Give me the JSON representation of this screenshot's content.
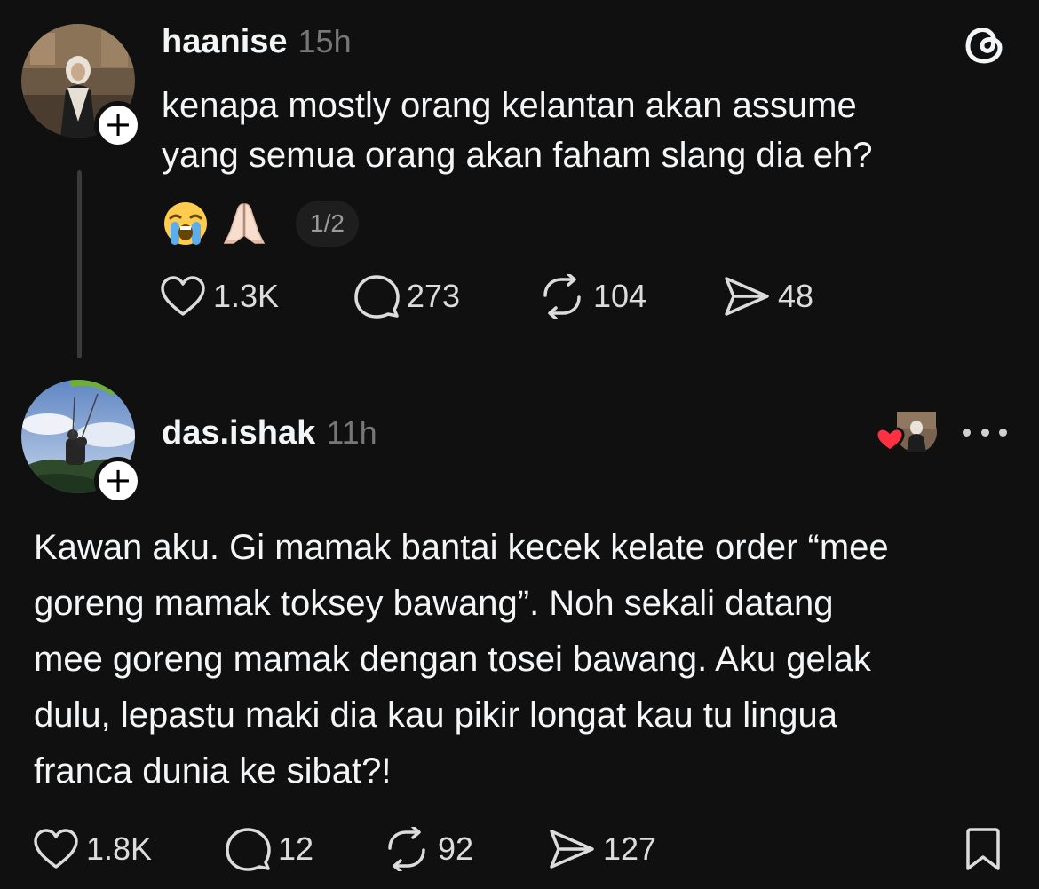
{
  "post1": {
    "username": "haanise",
    "time": "15h",
    "text": "kenapa mostly orang kelantan akan assume\nyang semua orang akan faham slang dia eh?",
    "emoji_icons": [
      "loudly-crying-face-icon",
      "folded-hands-icon"
    ],
    "page_indicator": "1/2",
    "likes": "1.3K",
    "replies": "273",
    "reposts": "104",
    "shares": "48"
  },
  "post2": {
    "username": "das.ishak",
    "time": "11h",
    "text": "Kawan aku. Gi mamak bantai kecek kelate order “mee\ngoreng mamak toksey bawang”. Noh sekali datang\nmee goreng mamak dengan tosei bawang. Aku gelak\ndulu, lepastu maki dia kau pikir longat kau tu lingua\nfranca dunia ke sibat?!",
    "likes": "1.8K",
    "replies": "12",
    "reposts": "92",
    "shares": "127"
  },
  "colors": {
    "background": "#101010",
    "text": "#f3f5f7",
    "muted": "#777777",
    "heart_red": "#ff3040"
  }
}
